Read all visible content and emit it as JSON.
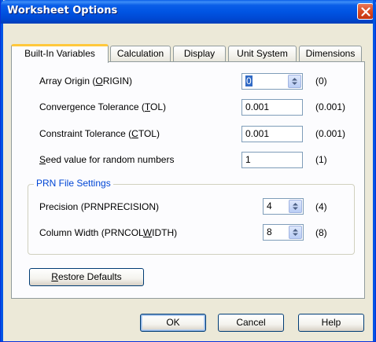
{
  "window": {
    "title": "Worksheet Options",
    "close_icon": "close-icon"
  },
  "tabs": [
    {
      "label": "Built-In Variables",
      "active": true
    },
    {
      "label": "Calculation",
      "active": false
    },
    {
      "label": "Display",
      "active": false
    },
    {
      "label": "Unit System",
      "active": false
    },
    {
      "label": "Dimensions",
      "active": false
    }
  ],
  "variables": {
    "array_origin": {
      "label_pre": "Array Origin  (",
      "label_ul": "O",
      "label_post": "RIGIN)",
      "value": "0",
      "default": "(0)"
    },
    "convergence": {
      "label_pre": "Convergence Tolerance  (",
      "label_ul": "T",
      "label_post": "OL)",
      "value": "0.001",
      "default": "(0.001)"
    },
    "constraint": {
      "label_pre": "Constraint Tolerance  (",
      "label_ul": "C",
      "label_post": "TOL)",
      "value": "0.001",
      "default": "(0.001)"
    },
    "seed": {
      "label_pre": "",
      "label_ul": "S",
      "label_post": "eed value for random numbers",
      "value": "1",
      "default": "(1)"
    }
  },
  "prn": {
    "group_title": "PRN File Settings",
    "precision": {
      "label": "Precision  (PRNPRECISION)",
      "value": "4",
      "default": "(4)"
    },
    "colwidth": {
      "label_pre": "Column Width  (PRNCOL",
      "label_ul": "W",
      "label_post": "IDTH)",
      "value": "8",
      "default": "(8)"
    }
  },
  "buttons": {
    "restore_ul": "R",
    "restore_rest": "estore Defaults",
    "ok": "OK",
    "cancel": "Cancel",
    "help": "Help"
  },
  "colors": {
    "titlebar": "#0054e3",
    "group_title": "#0046d5",
    "tab_highlight": "#ffc83c",
    "selection": "#316ac5"
  }
}
